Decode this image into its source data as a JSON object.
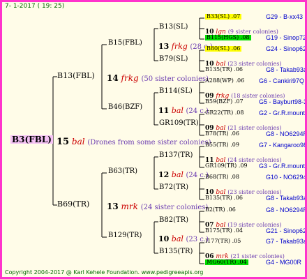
{
  "header": {
    "date": "7-  1-2017 ( 19: 25)"
  },
  "footer": {
    "copyright": "Copyright 2004-2017 @ Karl Kehele Foundation.   www.pedigreeapis.org"
  },
  "colors": {
    "frame": "#ff33cc",
    "yellow": "#ffff00",
    "green": "#00dd00",
    "line": "#000000"
  },
  "root": {
    "name": "B3(FBL)",
    "year": "15",
    "mark": "bal",
    "note": "(Drones from some sister colonies)"
  },
  "level1": [
    {
      "name": "B13(FBL)",
      "year": "14",
      "mark": "frkg",
      "note": "(50 sister colonies)"
    },
    {
      "name": "B69(TR)",
      "year": "13",
      "mark": "mrk",
      "note": "(24 sister colonies)"
    }
  ],
  "level2": [
    {
      "name": "B15(FBL)",
      "year": "13",
      "mark": "frkg",
      "note": "(28 c.)"
    },
    {
      "name": "B46(BZF)",
      "year": "11",
      "mark": "bal",
      "note": "(24 c.)"
    },
    {
      "name": "B63(TR)",
      "year": "12",
      "mark": "bal",
      "note": "(24 c.)"
    },
    {
      "name": "B129(TR)",
      "year": "10",
      "mark": "bal",
      "note": "(23 c.)"
    }
  ],
  "level3": [
    {
      "name": "B13(SL)"
    },
    {
      "name": "B79(SL)"
    },
    {
      "name": "B114(SL)"
    },
    {
      "name": "GR109(TR)"
    },
    {
      "name": "B137(TR)"
    },
    {
      "name": "B72(TR)"
    },
    {
      "name": "B82(TR)"
    },
    {
      "name": "B135(TR)"
    }
  ],
  "level4": [
    {
      "f": "B33(SL)  .07",
      "fId": "G29 - B-xx43",
      "fHl": "yellow",
      "y": "10",
      "m": "lgn",
      "n": "(9 sister colonies)",
      "d": "B115(HGS) .08",
      "dId": "G19 - Sinop72R",
      "dHl": "green"
    },
    {
      "f": "B80(SL)  .06",
      "fId": "G24 - Sinop62R",
      "fHl": "yellow",
      "y": "10",
      "m": "bal",
      "n": "(23 sister colonies)",
      "d": "B135(TR) .06",
      "dId": "G8 - Takab93aR",
      "dHl": ""
    },
    {
      "f": "A288(WP) .06",
      "fId": "G6 - Cankiri97Q",
      "fHl": "",
      "y": "09",
      "m": "frkg",
      "n": "(18 sister colonies)",
      "d": "B59(BZF) .07",
      "dId": "G5 - Bayburt98-3",
      "dHl": ""
    },
    {
      "f": "GR22(TR) .08",
      "fId": "G2 - Gr.R.mounta",
      "fHl": "",
      "y": "09",
      "m": "bal",
      "n": "(21 sister colonies)",
      "d": "B78(TR) .06",
      "dId": "G8 - NO6294R",
      "dHl": ""
    },
    {
      "f": "B55(TR) .09",
      "fId": "G7 - Kangaroo98R",
      "fHl": "",
      "y": "11",
      "m": "bal",
      "n": "(24 sister colonies)",
      "d": "GR109(TR) .09",
      "dId": "G3 - Gr.R.mounta",
      "dHl": ""
    },
    {
      "f": "B68(TR) .08",
      "fId": "G10 - NO6294R",
      "fHl": "",
      "y": "10",
      "m": "bal",
      "n": "(23 sister colonies)",
      "d": "B135(TR) .06",
      "dId": "G8 - Takab93aR",
      "dHl": ""
    },
    {
      "f": "B2(TR) .06",
      "fId": "G8 - NO6294R",
      "fHl": "",
      "y": "07",
      "m": "bal",
      "n": "(19 sister colonies)",
      "d": "B175(TR) .04",
      "dId": "G21 - Sinop62R",
      "dHl": ""
    },
    {
      "f": "I177(TR) .05",
      "fId": "G7 - Takab93aR",
      "fHl": "",
      "y": "06",
      "m": "mrk",
      "n": "(21 sister colonies)",
      "d": "MG60(TR) .04",
      "dId": "G4 - MG00R",
      "dHl": "green"
    }
  ]
}
